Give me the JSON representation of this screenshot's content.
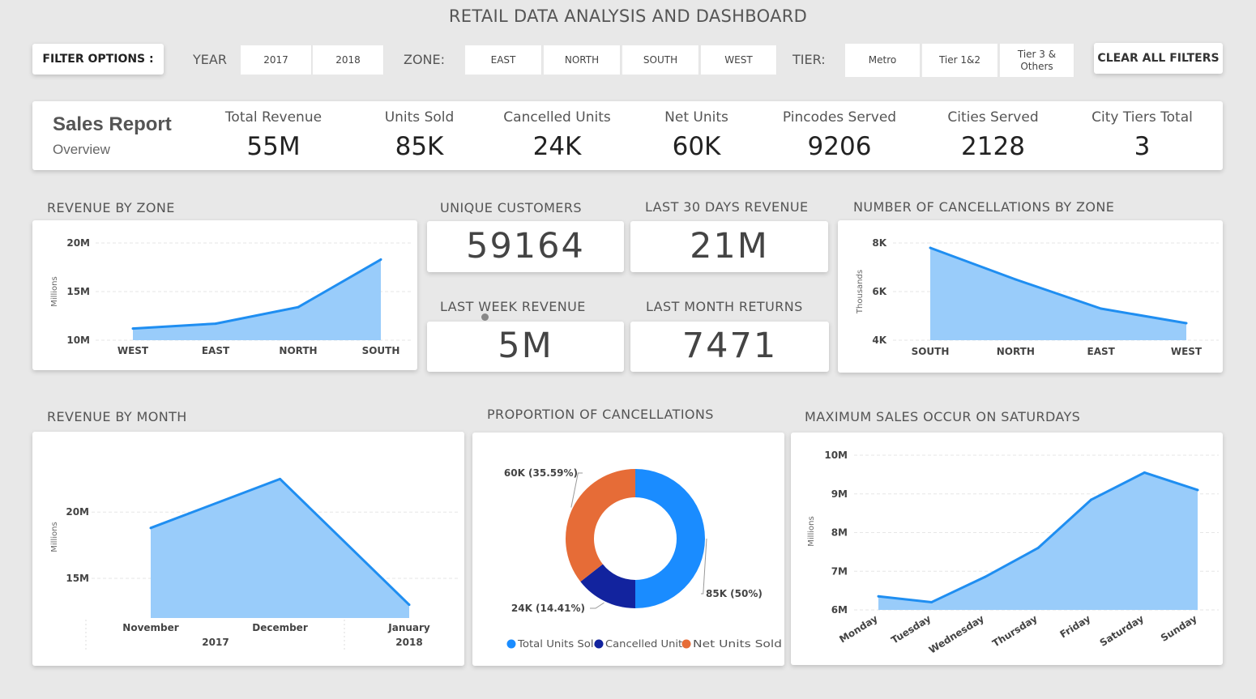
{
  "header": {
    "title": "RETAIL DATA ANALYSIS AND DASHBOARD"
  },
  "filters": {
    "label": "FILTER OPTIONS :",
    "year_label": "YEAR",
    "years": [
      "2017",
      "2018"
    ],
    "zone_label": "ZONE:",
    "zones": [
      "EAST",
      "NORTH",
      "SOUTH",
      "WEST"
    ],
    "tier_label": "TIER:",
    "tiers": [
      "Metro",
      "Tier 1&2",
      "Tier 3 & Others"
    ],
    "clear_label": "CLEAR ALL FILTERS"
  },
  "summary": {
    "title": "Sales Report",
    "subtitle": "Overview",
    "kpis": [
      {
        "label": "Total Revenue",
        "value": "55M"
      },
      {
        "label": "Units Sold",
        "value": "85K"
      },
      {
        "label": "Cancelled Units",
        "value": "24K"
      },
      {
        "label": "Net Units",
        "value": "60K"
      },
      {
        "label": "Pincodes Served",
        "value": "9206"
      },
      {
        "label": "Cities Served",
        "value": "2128"
      },
      {
        "label": "City Tiers Total",
        "value": "3"
      }
    ]
  },
  "cards": {
    "unique_customers": {
      "label": "UNIQUE CUSTOMERS",
      "value": "59164"
    },
    "last_30_days": {
      "label": "LAST 30 DAYS REVENUE",
      "value": "21M"
    },
    "last_week": {
      "label": "LAST WEEK REVENUE",
      "value": "5M"
    },
    "last_month_returns": {
      "label": "LAST MONTH RETURNS",
      "value": "7471"
    }
  },
  "colors": {
    "area_fill": "#99ccfa",
    "line": "#1f8ef1",
    "donut_blue": "#1a8cff",
    "donut_navy": "#12239e",
    "donut_orange": "#e66c37"
  },
  "chart_data": [
    {
      "id": "revenue_by_zone",
      "type": "area",
      "title": "REVENUE BY ZONE",
      "ylabel": "Millions",
      "categories": [
        "WEST",
        "EAST",
        "NORTH",
        "SOUTH"
      ],
      "values": [
        11.2,
        11.7,
        13.4,
        18.3
      ],
      "yticks": [
        "10M",
        "15M",
        "20M"
      ],
      "ylim": [
        10,
        20
      ],
      "grid": true
    },
    {
      "id": "cancellations_by_zone",
      "type": "area",
      "title": "NUMBER OF CANCELLATIONS BY ZONE",
      "ylabel": "Thousands",
      "categories": [
        "SOUTH",
        "NORTH",
        "EAST",
        "WEST"
      ],
      "values": [
        7.8,
        6.5,
        5.3,
        4.7
      ],
      "yticks": [
        "4K",
        "6K",
        "8K"
      ],
      "ylim": [
        4,
        8
      ],
      "grid": true
    },
    {
      "id": "revenue_by_month",
      "type": "area",
      "title": "REVENUE BY MONTH",
      "ylabel": "Millions",
      "categories": [
        "November",
        "December",
        "January"
      ],
      "year_labels": [
        "2017",
        "2018"
      ],
      "values": [
        18.8,
        22.5,
        13.0
      ],
      "yticks": [
        "15M",
        "20M"
      ],
      "grid": true
    },
    {
      "id": "proportion_of_cancellations",
      "type": "pie",
      "title": "PROPORTION OF CANCELLATIONS",
      "labels": [
        "Total Units Sold",
        "Cancelled Units",
        "Net Units Sold"
      ],
      "values": [
        50,
        14.41,
        35.59
      ],
      "data_labels": [
        "85K (50%)",
        "24K (14.41%)",
        "60K (35.59%)"
      ],
      "legend": "bottom"
    },
    {
      "id": "sales_by_weekday",
      "type": "area",
      "title": "MAXIMUM SALES OCCUR ON SATURDAYS",
      "ylabel": "Millions",
      "categories": [
        "Monday",
        "Tuesday",
        "Wednesday",
        "Thursday",
        "Friday",
        "Saturday",
        "Sunday"
      ],
      "values": [
        6.35,
        6.2,
        6.85,
        7.6,
        8.85,
        9.55,
        9.1
      ],
      "yticks": [
        "6M",
        "7M",
        "8M",
        "9M",
        "10M"
      ],
      "ylim": [
        6,
        10
      ],
      "grid": true
    }
  ]
}
